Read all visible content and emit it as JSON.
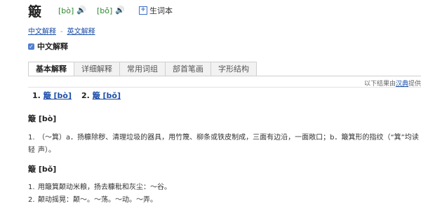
{
  "header": {
    "headword": "簸",
    "readings": [
      {
        "pinyin": "[bò]",
        "icon": "speaker-icon"
      },
      {
        "pinyin": "[bǒ]",
        "icon": "speaker-icon"
      }
    ],
    "vocab_label": "生词本"
  },
  "breadcrumbs": [
    "中文解释",
    "英文解释"
  ],
  "section_title": "中文解释",
  "tabs": [
    "基本解释",
    "详细解释",
    "常用词组",
    "部首笔画",
    "字形结构"
  ],
  "source": {
    "prefix": "以下结果由",
    "link": "汉典",
    "suffix": "提供"
  },
  "quick_links": [
    {
      "num": "1.",
      "text": "簸 [bò]"
    },
    {
      "num": "2.",
      "text": "簸 [bǒ]"
    }
  ],
  "entries": [
    {
      "title": "簸 [bò]",
      "defs": [
        {
          "num": "1.",
          "line1": "（～箕）a．扬糠除秽、清理垃圾的器具，用竹篾、柳条或铁皮制成，三面有边沿，一面敞口；b．簸箕形的指纹（“箕”均读轻",
          "line2": "声）。"
        }
      ]
    },
    {
      "title": "簸 [bǒ]",
      "defs": [
        {
          "num": "1.",
          "line1": "用簸箕颠动米粮，扬去糠秕和灰尘：～谷。"
        },
        {
          "num": "2.",
          "line1": "颠动摇晃：颠～。～荡。～动。～弄。"
        }
      ]
    }
  ]
}
